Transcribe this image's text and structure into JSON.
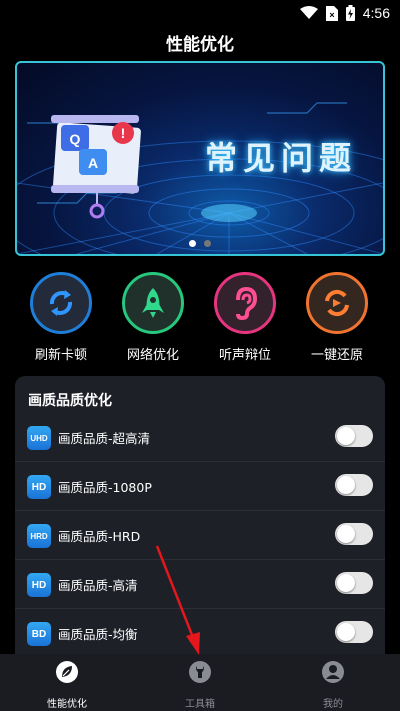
{
  "status_bar": {
    "time": "4:56"
  },
  "header": {
    "title": "性能优化"
  },
  "banner": {
    "text": "常见问题",
    "graphic_letters": [
      "Q",
      "A",
      "!"
    ],
    "active_slide": 1,
    "slide_count": 2
  },
  "quick_actions": [
    {
      "label": "刷新卡顿",
      "icon": "refresh-icon",
      "color": "#1f7ed8"
    },
    {
      "label": "网络优化",
      "icon": "rocket-icon",
      "color": "#27c77d"
    },
    {
      "label": "听声辩位",
      "icon": "ear-icon",
      "color": "#e6357f"
    },
    {
      "label": "一键还原",
      "icon": "restore-icon",
      "color": "#f07430"
    }
  ],
  "quality_section": {
    "title": "画质品质优化",
    "items": [
      {
        "badge": "UHD",
        "label": "画质品质-超高清",
        "enabled": false
      },
      {
        "badge": "HD",
        "label": "画质品质-1080P",
        "enabled": false
      },
      {
        "badge": "HRD",
        "label": "画质品质-HRD",
        "enabled": false
      },
      {
        "badge": "HD",
        "label": "画质品质-高清",
        "enabled": false
      },
      {
        "badge": "BD",
        "label": "画质品质-均衡",
        "enabled": false
      }
    ]
  },
  "bottom_nav": {
    "items": [
      {
        "label": "性能优化",
        "icon": "leaf-icon",
        "active": true
      },
      {
        "label": "工具箱",
        "icon": "wrench-icon",
        "active": false
      },
      {
        "label": "我的",
        "icon": "user-icon",
        "active": false
      }
    ]
  },
  "colors": {
    "background": "#000000",
    "card": "#1e2028",
    "accent_blue": "#1a72d6",
    "banner_border": "#36c4d6",
    "annotation_arrow": "#e3171c"
  }
}
